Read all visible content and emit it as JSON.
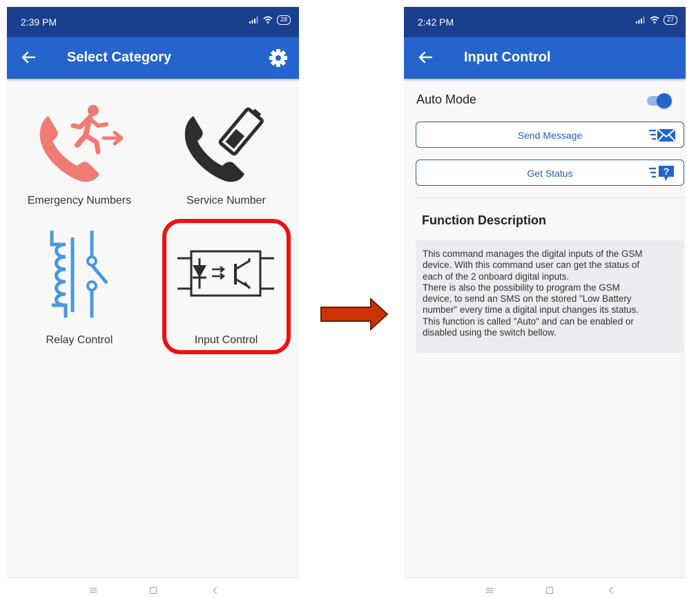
{
  "left_screen": {
    "status_time": "2:39 PM",
    "battery": "28",
    "title": "Select Category",
    "tiles": [
      {
        "label": "Emergency Numbers",
        "icon": "emergency-exit-phone-icon"
      },
      {
        "label": "Service Number",
        "icon": "phone-battery-icon"
      },
      {
        "label": "Relay Control",
        "icon": "relay-coil-icon"
      },
      {
        "label": "Input Control",
        "icon": "optocoupler-icon"
      }
    ]
  },
  "right_screen": {
    "status_time": "2:42 PM",
    "battery": "27",
    "title": "Input Control",
    "auto_mode_label": "Auto Mode",
    "auto_mode_on": true,
    "send_message_label": "Send Message",
    "get_status_label": "Get Status",
    "function_description_title": "Function Description",
    "description_lines": [
      "This command manages the digital inputs of the GSM",
      "device. With this command user can get the status of",
      "each of the 2 onboard digital inputs.",
      "There is also the possibility to program the GSM",
      "device, to send an SMS on the stored \"Low Battery",
      "number\" every time a digital input changes its status.",
      "This function is called \"Auto\" and can be enabled or",
      "disabled using the switch bellow."
    ]
  },
  "colors": {
    "status_bar": "#1b3f8f",
    "app_bar": "#2464cc",
    "emergency_icon": "#ef7b72",
    "relay_icon": "#4a98de",
    "highlight": "#ee1111",
    "arrow": "#cc3300"
  }
}
